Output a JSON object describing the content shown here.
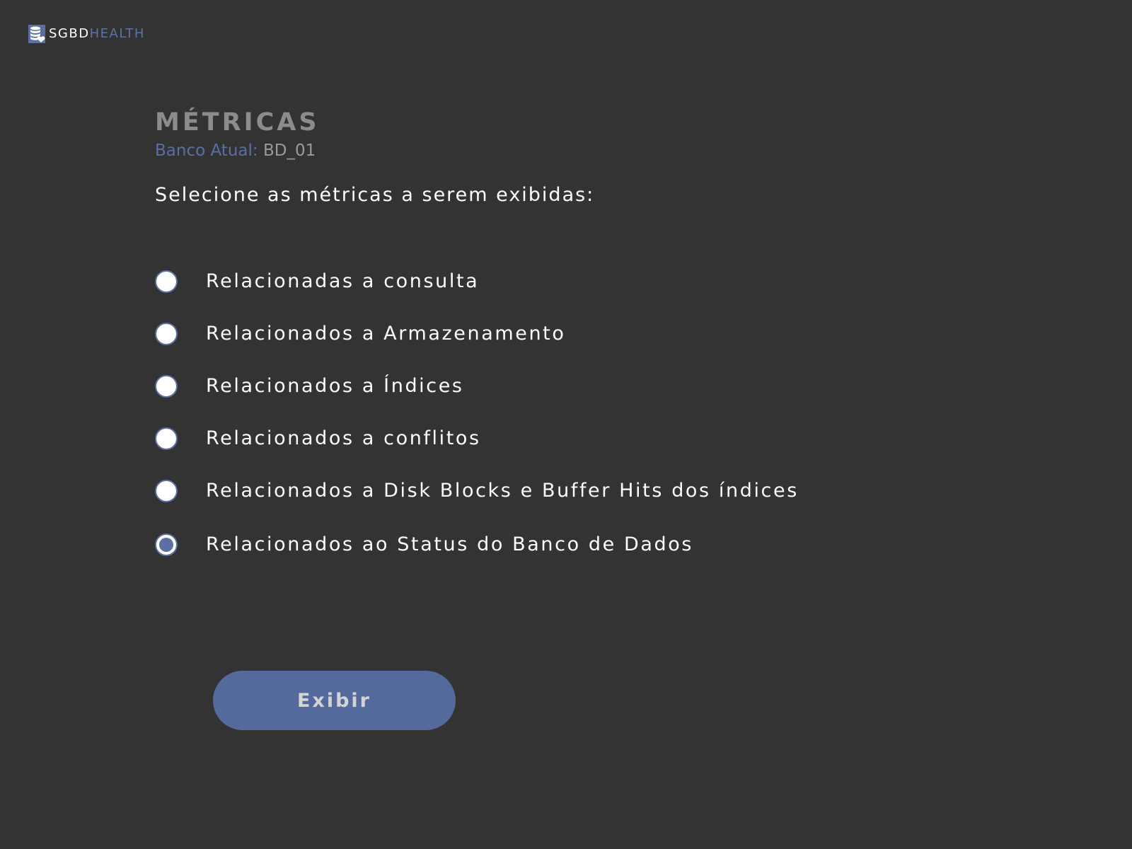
{
  "brand": {
    "name_part1": "SGBD",
    "name_part2": "HEALTH"
  },
  "page": {
    "title": "MÉTRICAS",
    "current_db_label": "Banco Atual:",
    "current_db_value": "BD_01",
    "instruction": "Selecione as métricas a serem exibidas:"
  },
  "options": [
    {
      "label": "Relacionadas a consulta",
      "selected": false
    },
    {
      "label": "Relacionados a Armazenamento",
      "selected": false
    },
    {
      "label": "Relacionados a Índices",
      "selected": false
    },
    {
      "label": "Relacionados a conflitos",
      "selected": false
    },
    {
      "label": "Relacionados a Disk Blocks e Buffer Hits dos índices",
      "selected": false
    },
    {
      "label": "Relacionados ao Status do Banco de Dados",
      "selected": true
    }
  ],
  "action": {
    "button_label": "Exibir"
  },
  "colors": {
    "background": "#333333",
    "accent": "#546a9c",
    "title_gray": "#8c8c8c"
  },
  "icons": {
    "logo": "database-heart-icon",
    "radio_unselected": "radio-unchecked",
    "radio_selected": "radio-checked"
  }
}
